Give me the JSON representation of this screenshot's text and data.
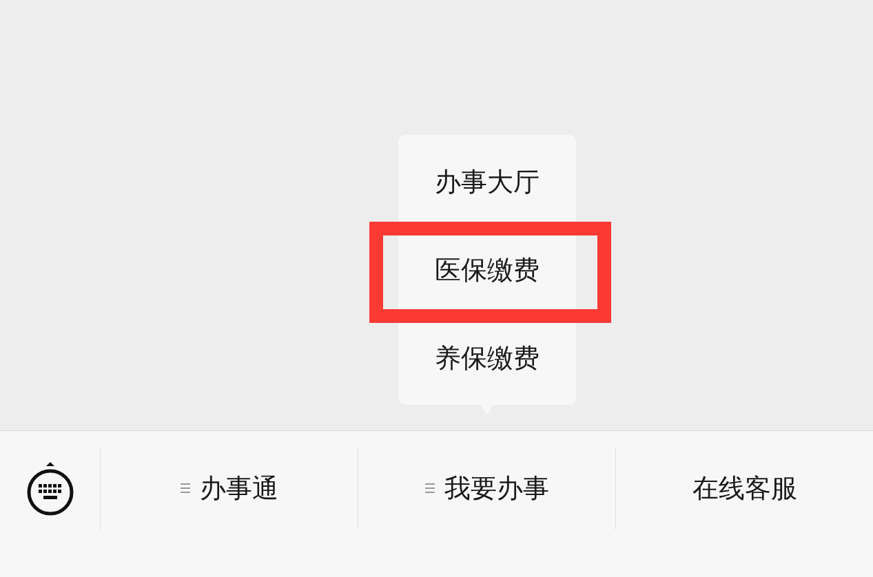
{
  "menus": [
    {
      "label": "办事通",
      "has_submenu": true,
      "expanded": false
    },
    {
      "label": "我要办事",
      "has_submenu": true,
      "expanded": true,
      "items": [
        {
          "label": "办事大厅",
          "highlighted": false
        },
        {
          "label": "医保缴费",
          "highlighted": true
        },
        {
          "label": "养保缴费",
          "highlighted": false
        }
      ]
    },
    {
      "label": "在线客服",
      "has_submenu": false
    }
  ]
}
